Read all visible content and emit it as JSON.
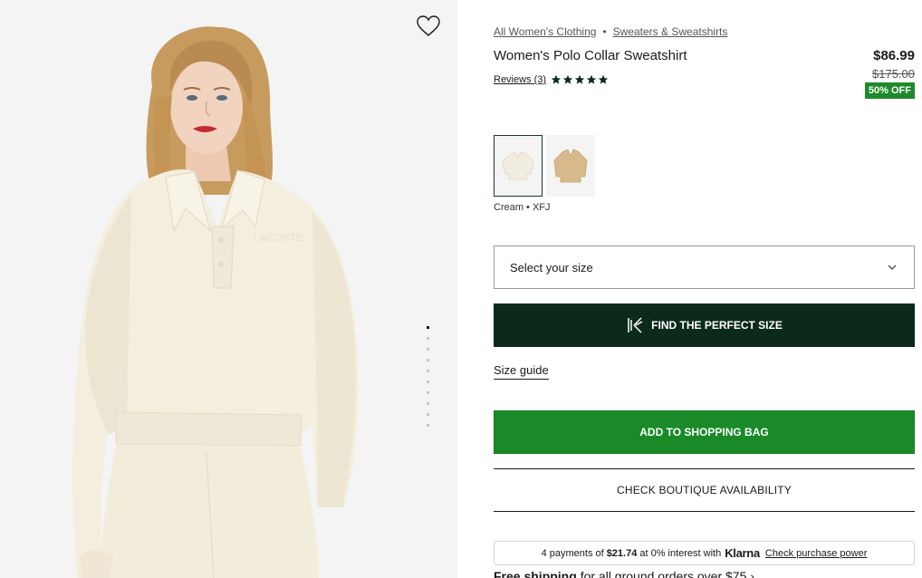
{
  "gallery": {
    "image_alt": "Model wearing cream polo collar sweatshirt",
    "embossed_logo": "LACOSTE",
    "slide_count": 10,
    "active_slide": 1
  },
  "breadcrumb": {
    "items": [
      "All Women's Clothing",
      "Sweaters & Sweatshirts"
    ],
    "separator": "•"
  },
  "product": {
    "title": "Women's Polo Collar Sweatshirt",
    "reviews_label": "Reviews (3)",
    "rating": 5,
    "price": "$86.99",
    "old_price": "$175.00",
    "discount": "50% OFF"
  },
  "colors": {
    "swatches": [
      {
        "name": "Cream",
        "hex": "#f1ede0",
        "selected": true
      },
      {
        "name": "Beige",
        "hex": "#d8b98c",
        "selected": false
      }
    ],
    "selected_label": "Cream • XFJ"
  },
  "size": {
    "placeholder": "Select your size",
    "find_label": "FIND THE PERFECT SIZE",
    "guide_label": "Size guide"
  },
  "actions": {
    "add_to_bag": "ADD TO SHOPPING BAG",
    "boutique": "CHECK BOUTIQUE AVAILABILITY"
  },
  "klarna": {
    "prefix": "4 payments of",
    "amount": "$21.74",
    "suffix": "at 0% interest with",
    "brand": "Klarna",
    "link": "Check purchase power"
  },
  "shipping": {
    "bold": "Free shipping",
    "rest": "for all ground orders over $75",
    "arrow": "›"
  },
  "colors_theme": {
    "dark_green": "#0b2a1c",
    "brand_green": "#1a8a28",
    "discount_green": "#1d8a2b"
  }
}
